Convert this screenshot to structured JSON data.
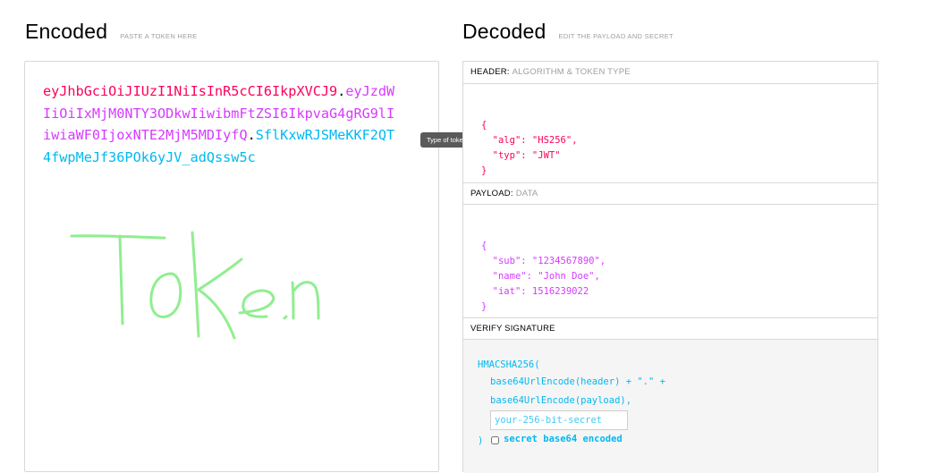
{
  "encoded": {
    "title": "Encoded",
    "subtitle": "PASTE A TOKEN HERE",
    "token_header": "eyJhbGciOiJIUzI1NiIsInR5cCI6IkpXVCJ9",
    "dot": ".",
    "token_payload": "eyJzdWIiOiIxMjM0NTY3ODkwIiwibmFtZSI6IkpvaG4gRG9lIiwiaWF0IjoxNTE2MjM5MDIyfQ",
    "token_signature": "SflKxwRJSMeKKF2QT4fwpMeJf36POk6yJV_adQssw5c",
    "drawing_color": "#90ee90"
  },
  "tooltip": {
    "text": "Type of token"
  },
  "decoded": {
    "title": "Decoded",
    "subtitle": "EDIT THE PAYLOAD AND SECRET",
    "header_label": "HEADER:",
    "header_sub": "ALGORITHM & TOKEN TYPE",
    "header_json": {
      "open": "{",
      "alg_key": "\"alg\"",
      "alg_val": "\"HS256\"",
      "typ_key": "\"typ\"",
      "typ_val": "\"JWT\"",
      "close": "}"
    },
    "payload_label": "PAYLOAD:",
    "payload_sub": "DATA",
    "payload_json": {
      "open": "{",
      "sub_key": "\"sub\"",
      "sub_val": "\"1234567890\"",
      "name_key": "\"name\"",
      "name_val": "\"John Doe\"",
      "iat_key": "\"iat\"",
      "iat_val": "1516239022",
      "close": "}"
    },
    "verify_label": "VERIFY SIGNATURE",
    "verify": {
      "fn_open": "HMACSHA256(",
      "line1": "base64UrlEncode(header) + \".\" +",
      "line2": "base64UrlEncode(payload),",
      "secret_placeholder": "your-256-bit-secret",
      "close": ")",
      "b64_label": "secret base64 encoded"
    }
  },
  "colors": {
    "header": "#fb015b",
    "payload": "#d63aff",
    "signature": "#00b9f1"
  }
}
